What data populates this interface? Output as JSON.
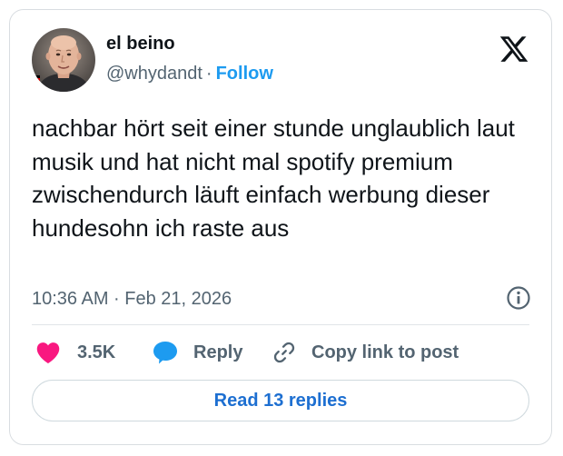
{
  "author": {
    "display_name": "el beino",
    "handle": "@whydandt",
    "separator": "·",
    "follow_label": "Follow"
  },
  "tweet": {
    "text": "nachbar hört seit einer stunde unglaublich laut musik und hat nicht mal spotify premium zwischendurch läuft einfach werbung dieser hundesohn ich raste aus",
    "timestamp": "10:36 AM · Feb 21, 2026"
  },
  "actions": {
    "like_count": "3.5K",
    "reply_label": "Reply",
    "copy_link_label": "Copy link to post"
  },
  "footer": {
    "read_replies_label": "Read 13 replies"
  },
  "icons": {
    "logo": "x-logo-icon",
    "info": "info-icon",
    "like": "heart-icon",
    "reply": "speech-bubble-icon",
    "copy": "link-icon"
  },
  "colors": {
    "heart": "#f91880",
    "reply_bubble": "#1d9bf0",
    "follow": "#1d9bf0",
    "read_replies": "#1d6fd1",
    "secondary_text": "#536471"
  }
}
